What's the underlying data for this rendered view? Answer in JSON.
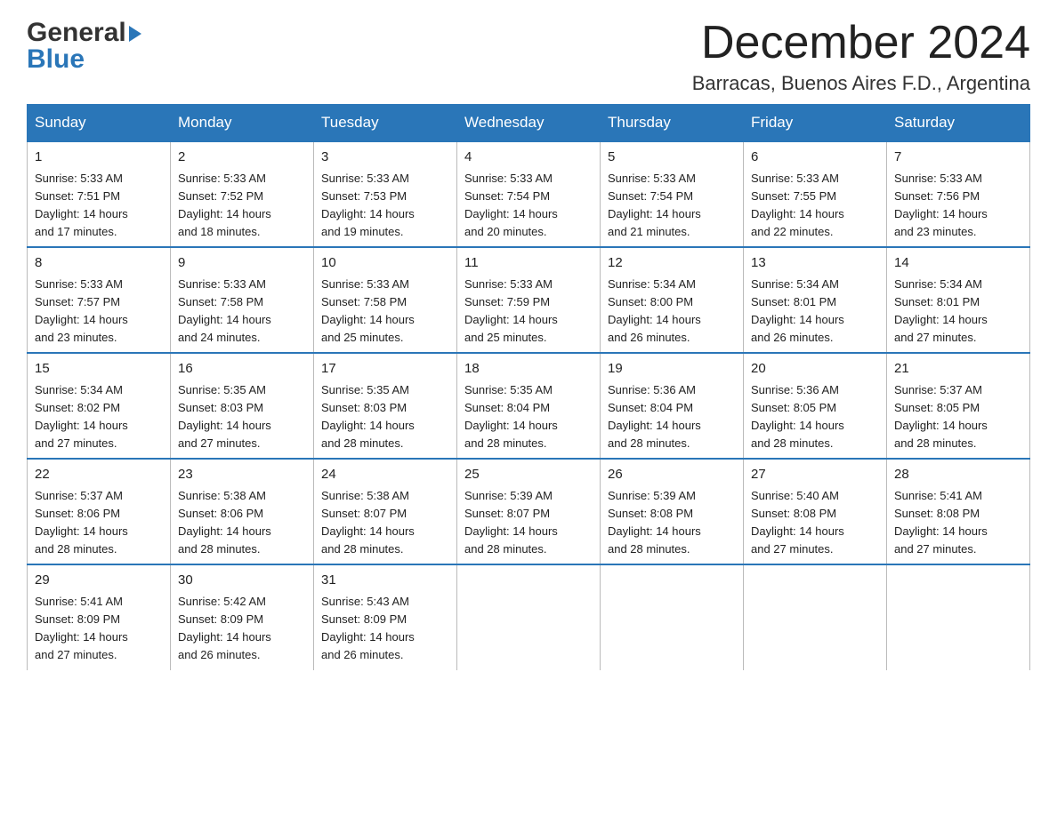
{
  "header": {
    "logo_general": "General",
    "logo_blue": "Blue",
    "month_title": "December 2024",
    "location": "Barracas, Buenos Aires F.D., Argentina"
  },
  "weekdays": [
    "Sunday",
    "Monday",
    "Tuesday",
    "Wednesday",
    "Thursday",
    "Friday",
    "Saturday"
  ],
  "weeks": [
    [
      {
        "day": "1",
        "sunrise": "5:33 AM",
        "sunset": "7:51 PM",
        "daylight": "14 hours and 17 minutes."
      },
      {
        "day": "2",
        "sunrise": "5:33 AM",
        "sunset": "7:52 PM",
        "daylight": "14 hours and 18 minutes."
      },
      {
        "day": "3",
        "sunrise": "5:33 AM",
        "sunset": "7:53 PM",
        "daylight": "14 hours and 19 minutes."
      },
      {
        "day": "4",
        "sunrise": "5:33 AM",
        "sunset": "7:54 PM",
        "daylight": "14 hours and 20 minutes."
      },
      {
        "day": "5",
        "sunrise": "5:33 AM",
        "sunset": "7:54 PM",
        "daylight": "14 hours and 21 minutes."
      },
      {
        "day": "6",
        "sunrise": "5:33 AM",
        "sunset": "7:55 PM",
        "daylight": "14 hours and 22 minutes."
      },
      {
        "day": "7",
        "sunrise": "5:33 AM",
        "sunset": "7:56 PM",
        "daylight": "14 hours and 23 minutes."
      }
    ],
    [
      {
        "day": "8",
        "sunrise": "5:33 AM",
        "sunset": "7:57 PM",
        "daylight": "14 hours and 23 minutes."
      },
      {
        "day": "9",
        "sunrise": "5:33 AM",
        "sunset": "7:58 PM",
        "daylight": "14 hours and 24 minutes."
      },
      {
        "day": "10",
        "sunrise": "5:33 AM",
        "sunset": "7:58 PM",
        "daylight": "14 hours and 25 minutes."
      },
      {
        "day": "11",
        "sunrise": "5:33 AM",
        "sunset": "7:59 PM",
        "daylight": "14 hours and 25 minutes."
      },
      {
        "day": "12",
        "sunrise": "5:34 AM",
        "sunset": "8:00 PM",
        "daylight": "14 hours and 26 minutes."
      },
      {
        "day": "13",
        "sunrise": "5:34 AM",
        "sunset": "8:01 PM",
        "daylight": "14 hours and 26 minutes."
      },
      {
        "day": "14",
        "sunrise": "5:34 AM",
        "sunset": "8:01 PM",
        "daylight": "14 hours and 27 minutes."
      }
    ],
    [
      {
        "day": "15",
        "sunrise": "5:34 AM",
        "sunset": "8:02 PM",
        "daylight": "14 hours and 27 minutes."
      },
      {
        "day": "16",
        "sunrise": "5:35 AM",
        "sunset": "8:03 PM",
        "daylight": "14 hours and 27 minutes."
      },
      {
        "day": "17",
        "sunrise": "5:35 AM",
        "sunset": "8:03 PM",
        "daylight": "14 hours and 28 minutes."
      },
      {
        "day": "18",
        "sunrise": "5:35 AM",
        "sunset": "8:04 PM",
        "daylight": "14 hours and 28 minutes."
      },
      {
        "day": "19",
        "sunrise": "5:36 AM",
        "sunset": "8:04 PM",
        "daylight": "14 hours and 28 minutes."
      },
      {
        "day": "20",
        "sunrise": "5:36 AM",
        "sunset": "8:05 PM",
        "daylight": "14 hours and 28 minutes."
      },
      {
        "day": "21",
        "sunrise": "5:37 AM",
        "sunset": "8:05 PM",
        "daylight": "14 hours and 28 minutes."
      }
    ],
    [
      {
        "day": "22",
        "sunrise": "5:37 AM",
        "sunset": "8:06 PM",
        "daylight": "14 hours and 28 minutes."
      },
      {
        "day": "23",
        "sunrise": "5:38 AM",
        "sunset": "8:06 PM",
        "daylight": "14 hours and 28 minutes."
      },
      {
        "day": "24",
        "sunrise": "5:38 AM",
        "sunset": "8:07 PM",
        "daylight": "14 hours and 28 minutes."
      },
      {
        "day": "25",
        "sunrise": "5:39 AM",
        "sunset": "8:07 PM",
        "daylight": "14 hours and 28 minutes."
      },
      {
        "day": "26",
        "sunrise": "5:39 AM",
        "sunset": "8:08 PM",
        "daylight": "14 hours and 28 minutes."
      },
      {
        "day": "27",
        "sunrise": "5:40 AM",
        "sunset": "8:08 PM",
        "daylight": "14 hours and 27 minutes."
      },
      {
        "day": "28",
        "sunrise": "5:41 AM",
        "sunset": "8:08 PM",
        "daylight": "14 hours and 27 minutes."
      }
    ],
    [
      {
        "day": "29",
        "sunrise": "5:41 AM",
        "sunset": "8:09 PM",
        "daylight": "14 hours and 27 minutes."
      },
      {
        "day": "30",
        "sunrise": "5:42 AM",
        "sunset": "8:09 PM",
        "daylight": "14 hours and 26 minutes."
      },
      {
        "day": "31",
        "sunrise": "5:43 AM",
        "sunset": "8:09 PM",
        "daylight": "14 hours and 26 minutes."
      },
      null,
      null,
      null,
      null
    ]
  ],
  "labels": {
    "sunrise": "Sunrise:",
    "sunset": "Sunset:",
    "daylight": "Daylight:"
  }
}
